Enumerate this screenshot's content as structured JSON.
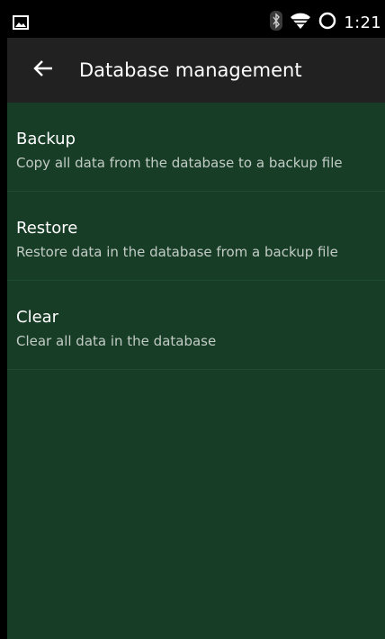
{
  "status_bar": {
    "time": "1:21",
    "icons": [
      "image-notification-icon",
      "bluetooth-icon",
      "wifi-icon",
      "battery-icon"
    ]
  },
  "app_bar": {
    "back_icon": "arrow-back-icon",
    "title": "Database management"
  },
  "preferences": [
    {
      "title": "Backup",
      "summary": "Copy all data from the database to a backup file"
    },
    {
      "title": "Restore",
      "summary": "Restore data in the database from a backup file"
    },
    {
      "title": "Clear",
      "summary": "Clear all data in the database"
    }
  ],
  "colors": {
    "app_bar": "#212121",
    "content_background": "#173d26",
    "status_bar": "#000000"
  }
}
